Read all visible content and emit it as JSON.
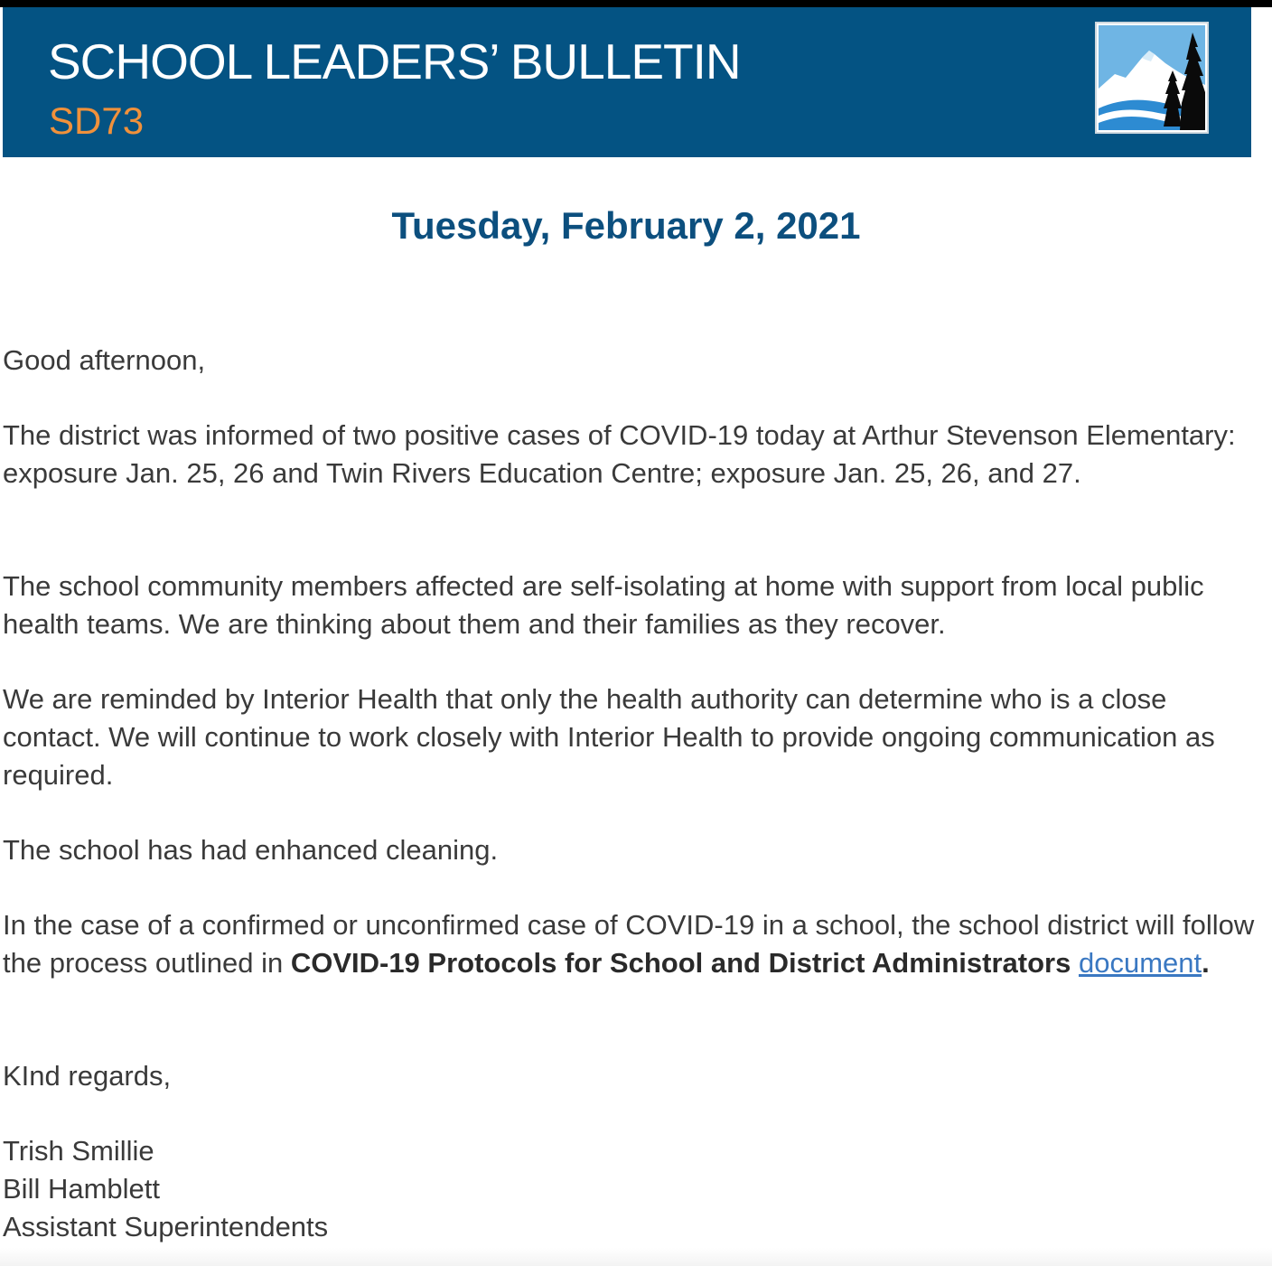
{
  "header": {
    "title": "SCHOOL LEADERS’ BULLETIN",
    "subtitle": "SD73",
    "logo_icon": "mountain-trees-logo-icon",
    "colors": {
      "banner_bg": "#045383",
      "subtitle": "#f0913b",
      "date": "#0c4f7e",
      "link": "#3a78c2"
    }
  },
  "date": "Tuesday, February 2, 2021",
  "body": {
    "greeting": "Good afternoon,",
    "paragraph1": "The district was informed of two positive cases of COVID-19 today at Arthur Stevenson Elementary: exposure Jan. 25, 26 and Twin Rivers Education Centre; exposure Jan. 25, 26, and  27.",
    "paragraph2": "The school community members affected are self-isolating at home with support from local public health teams. We are thinking about them and their families as they recover.",
    "paragraph3": "We are reminded by Interior Health that only the health authority can determine who is a close contact. We will continue to work closely with Interior Health to provide ongoing communication as required.",
    "paragraph4": "The school has had enhanced cleaning.",
    "paragraph5_pre": "In the case of a confirmed or unconfirmed case of COVID-19 in a school, the school district will follow the process outlined in ",
    "paragraph5_bold": "COVID-19 Protocols for School and District Administrators",
    "paragraph5_link": "document",
    "paragraph5_end": ".",
    "closing": "KInd regards,",
    "signature": {
      "name1": "Trish Smillie",
      "name2": "Bill Hamblett",
      "role": "Assistant Superintendents"
    }
  }
}
